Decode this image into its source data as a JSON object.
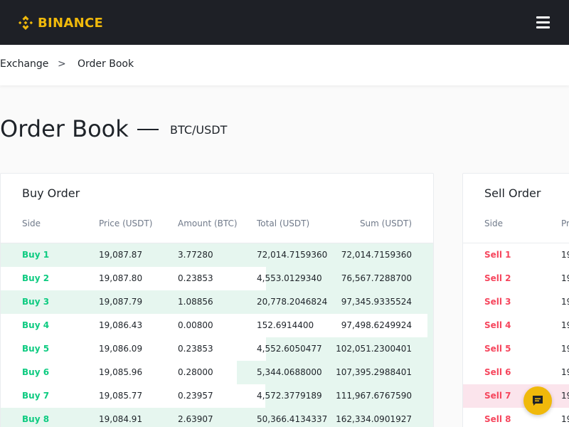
{
  "header": {
    "brand": "BINANCE",
    "menu_icon": "hamburger-menu-icon",
    "brand_color": "#f0b90b"
  },
  "breadcrumb": {
    "items": [
      "Exchange",
      "Order Book"
    ],
    "separator": ">"
  },
  "page": {
    "title": "Order Book",
    "pair": "BTC/USDT"
  },
  "buy": {
    "title": "Buy Order",
    "columns": [
      "Side",
      "Price (USDT)",
      "Amount (BTC)",
      "Total (USDT)",
      "Sum (USDT)"
    ],
    "rows": [
      {
        "side": "Buy 1",
        "price": "19,087.87",
        "amount": "3.77280",
        "total": "72,014.7159360",
        "sum": "72,014.7159360",
        "depth": 1.0
      },
      {
        "side": "Buy 2",
        "price": "19,087.80",
        "amount": "0.23853",
        "total": "4,553.0129340",
        "sum": "76,567.7288700",
        "depth": 0.385
      },
      {
        "side": "Buy 3",
        "price": "19,087.79",
        "amount": "1.08856",
        "total": "20,778.2046824",
        "sum": "97,345.9335524",
        "depth": 1.0
      },
      {
        "side": "Buy 4",
        "price": "19,086.43",
        "amount": "0.00800",
        "total": "152.6914400",
        "sum": "97,498.6249924",
        "depth": 0.013
      },
      {
        "side": "Buy 5",
        "price": "19,086.09",
        "amount": "0.23853",
        "total": "4,552.6050477",
        "sum": "102,051.2300401",
        "depth": 0.385
      },
      {
        "side": "Buy 6",
        "price": "19,085.96",
        "amount": "0.28000",
        "total": "5,344.0688000",
        "sum": "107,395.2988401",
        "depth": 0.452
      },
      {
        "side": "Buy 7",
        "price": "19,085.77",
        "amount": "0.23957",
        "total": "4,572.3779189",
        "sum": "111,967.6767590",
        "depth": 0.387
      },
      {
        "side": "Buy 8",
        "price": "19,084.91",
        "amount": "2.63907",
        "total": "50,366.4134337",
        "sum": "162,334.0901927",
        "depth": 1.0
      }
    ]
  },
  "sell": {
    "title": "Sell Order",
    "columns": [
      "Side",
      "Pr"
    ],
    "rows": [
      {
        "side": "Sell 1",
        "price": "19"
      },
      {
        "side": "Sell 2",
        "price": "19"
      },
      {
        "side": "Sell 3",
        "price": "19"
      },
      {
        "side": "Sell 4",
        "price": "19"
      },
      {
        "side": "Sell 5",
        "price": "19"
      },
      {
        "side": "Sell 6",
        "price": "19"
      },
      {
        "side": "Sell 7",
        "price": "19",
        "highlight": true
      },
      {
        "side": "Sell 8",
        "price": "19"
      }
    ]
  },
  "chat": {
    "icon": "chat-icon"
  }
}
